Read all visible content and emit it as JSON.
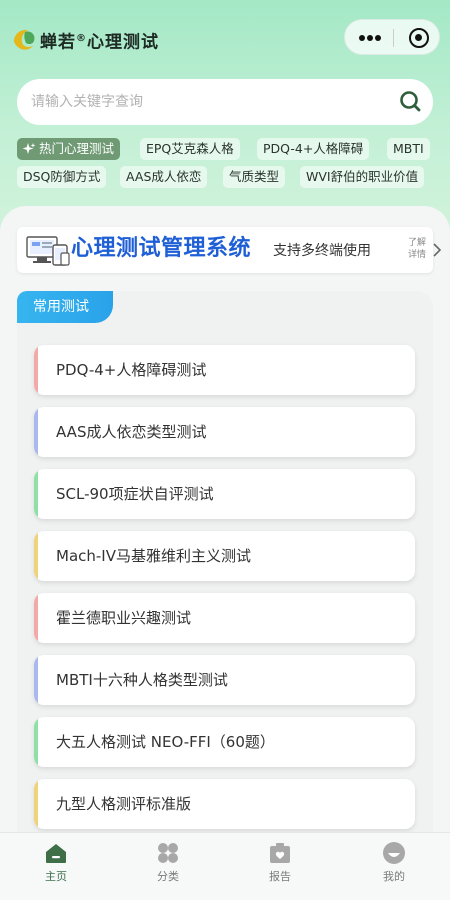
{
  "header": {
    "title": "蝉若",
    "trademark": "®",
    "title_suffix": "心理测试",
    "menu_icon": "more-dots-icon",
    "close_icon": "target-circle-icon"
  },
  "search": {
    "placeholder": "请输入关键字查询",
    "value": "",
    "icon": "search-icon"
  },
  "tags": [
    {
      "label": "热门心理测试",
      "icon": "sparkle-icon",
      "active": true
    },
    {
      "label": "EPQ艾克森人格"
    },
    {
      "label": "PDQ-4+人格障碍"
    },
    {
      "label": "MBTI"
    },
    {
      "label": "DSQ防御方式"
    },
    {
      "label": "AAS成人依恋"
    },
    {
      "label": "气质类型"
    },
    {
      "label": "WVI舒伯的职业价值"
    }
  ],
  "banner": {
    "title": "心理测试管理系统",
    "subtitle": "支持多终端使用",
    "more": "了解详情",
    "title_color": "#1f5fd6"
  },
  "section": {
    "title": "常用测试",
    "accent": "#2aa2ea"
  },
  "tests": [
    {
      "label": "PDQ-4+人格障碍测试",
      "color": "#f4a9a9"
    },
    {
      "label": "AAS成人依恋类型测试",
      "color": "#a9b8ee"
    },
    {
      "label": "SCL-90项症状自评测试",
      "color": "#8ee0a6"
    },
    {
      "label": "Mach-IV马基雅维利主义测试",
      "color": "#eed37a"
    },
    {
      "label": "霍兰德职业兴趣测试",
      "color": "#f4a9a9"
    },
    {
      "label": "MBTI十六种人格类型测试",
      "color": "#a9b8ee"
    },
    {
      "label": "大五人格测试 NEO-FFI（60题）",
      "color": "#8ee0a6"
    },
    {
      "label": "九型人格测评标准版",
      "color": "#eed37a"
    }
  ],
  "tabbar": [
    {
      "label": "主页",
      "icon": "home-icon",
      "active": true
    },
    {
      "label": "分类",
      "icon": "category-icon"
    },
    {
      "label": "报告",
      "icon": "report-icon"
    },
    {
      "label": "我的",
      "icon": "profile-icon"
    }
  ]
}
